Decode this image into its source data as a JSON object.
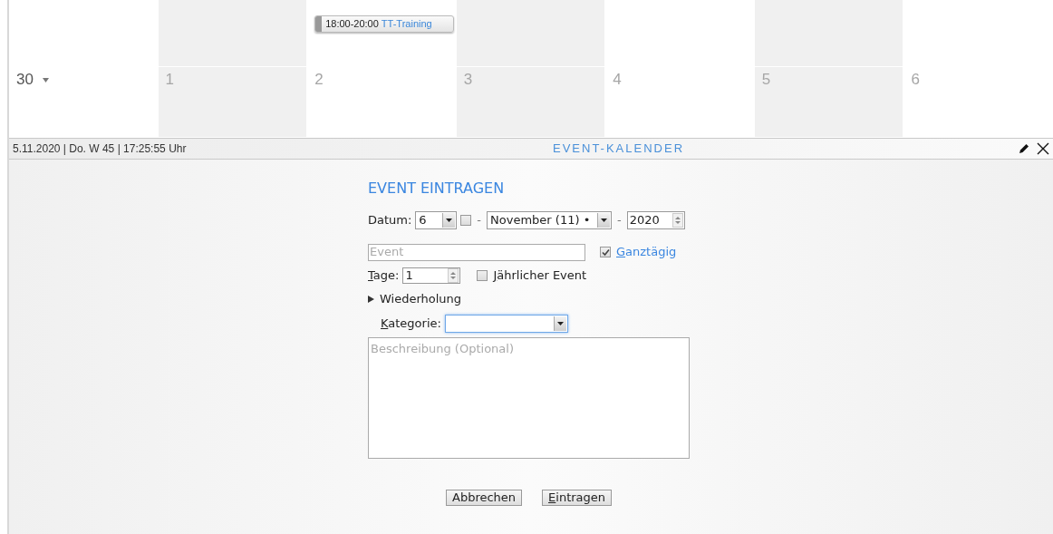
{
  "calendar": {
    "weeks": [
      {
        "days": [
          {
            "shaded": false
          },
          {
            "shaded": true
          },
          {
            "shaded": false,
            "events": [
              {
                "time": "18:00-20:00",
                "title": "TT-Training"
              }
            ]
          },
          {
            "shaded": true
          },
          {
            "shaded": false
          },
          {
            "shaded": true
          },
          {
            "shaded": false
          }
        ]
      },
      {
        "days": [
          {
            "number": "30",
            "shaded": false,
            "other_month": false,
            "menu_arrow": true
          },
          {
            "number": "1",
            "shaded": true,
            "other_month": true,
            "menu_arrow": false
          },
          {
            "number": "2",
            "shaded": false,
            "other_month": true,
            "menu_arrow": false
          },
          {
            "number": "3",
            "shaded": true,
            "other_month": true,
            "menu_arrow": false
          },
          {
            "number": "4",
            "shaded": false,
            "other_month": true,
            "menu_arrow": false
          },
          {
            "number": "5",
            "shaded": true,
            "other_month": true,
            "menu_arrow": false
          },
          {
            "number": "6",
            "shaded": false,
            "other_month": true,
            "menu_arrow": false
          }
        ]
      }
    ]
  },
  "status_bar": {
    "datetime": "5.11.2020 | Do. W 45 | 17:25:55 Uhr",
    "title": "EVENT-KALENDER"
  },
  "form": {
    "title": "EVENT EINTRAGEN",
    "date": {
      "label": "Datum:",
      "day": "6",
      "day_checked": false,
      "separator_1": "-",
      "month": "November (11) •",
      "separator_2": "-",
      "year": "2020"
    },
    "event_field": {
      "placeholder": "Event"
    },
    "all_day": {
      "label": "Ganztägig",
      "checked": true
    },
    "days": {
      "label": "Tage:",
      "value": "1"
    },
    "yearly": {
      "label": "Jährlicher Event",
      "checked": false
    },
    "repeat": {
      "label": "Wiederholung",
      "expanded": false
    },
    "category": {
      "label": "Kategorie:",
      "focused": true
    },
    "description": {
      "placeholder": "Beschreibung (Optional)"
    },
    "buttons": [
      {
        "label": "Abbrechen",
        "accesskey": false
      },
      {
        "label": "Eintragen",
        "accesskey": true
      }
    ]
  }
}
